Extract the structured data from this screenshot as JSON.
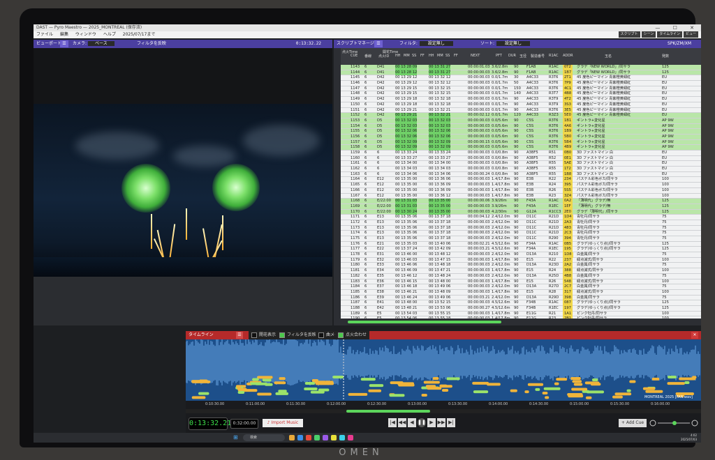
{
  "window": {
    "title": "DAST — Pyro Maestro — 2025_MONTREAL (保存済)",
    "menu": [
      "ファイル",
      "編集",
      "ウィンドウ",
      "ヘルプ",
      "2025/07/17まで"
    ],
    "toolbar_right": [
      "スクリプト",
      "シーン",
      "タイムライン",
      "ビュー"
    ]
  },
  "viewport": {
    "title": "ビューポート",
    "camera_label": "カメラ:",
    "camera_value": "ベース",
    "filter_toggle": "フィルタを反映",
    "timecode": "0:13:32.22"
  },
  "script_manager": {
    "title": "スクリプトマネージャー",
    "filter_label": "フィルタ:",
    "filter_value": "設定無し",
    "sort_label": "ソート:",
    "sort_value": "設定無し",
    "right_label": "SPK/ZM/XM",
    "columns": [
      "CUE",
      "番線",
      "点火ID",
      "HH",
      "MM",
      "SS",
      "FF",
      "HH",
      "MM",
      "SS",
      "FF",
      "NEXT",
      "PFT",
      "DUR",
      "玉径",
      "製造番号",
      "R1AC",
      "ADDR",
      "玉名",
      "発数"
    ],
    "group_headers": [
      "点火Time",
      "開花Time"
    ],
    "rows": [
      {
        "cue": "1143",
        "line": "6",
        "id": "D41",
        "t": "00 13 28 09",
        "b": "00 13 31 27",
        "next": "00:00:01.03",
        "spec": "3.6/2.8m",
        "dur": "90",
        "code": "F1AB",
        "r": "R1AC",
        "addr": "0T2",
        "name": "グラデ「NEW WORLD」/同サラ",
        "n": "125",
        "hl": "g"
      },
      {
        "cue": "1144",
        "line": "6",
        "id": "D41",
        "t": "00 13 28 12",
        "b": "00 13 31 27",
        "next": "00:00:00.03",
        "spec": "3.6/2.8m",
        "dur": "90",
        "code": "F1AB",
        "r": "R1AC",
        "addr": "1B7",
        "name": "グラデ「NEW WORLD」/同サラ",
        "n": "125",
        "hl": "g"
      },
      {
        "cue": "1145",
        "line": "6",
        "id": "D42",
        "t": "00 13 29 12",
        "b": "00 13 32 12",
        "next": "00:00:00.03",
        "spec": "0.0/1.7m",
        "dur": "30",
        "code": "A4C33",
        "r": "R3T6",
        "addr": "2T1",
        "name": "45 度色ピーマイン 青紫橙黄緑紅",
        "n": "EU",
        "hl": "w"
      },
      {
        "cue": "1146",
        "line": "6",
        "id": "D42",
        "t": "00 13 29 12",
        "b": "00 13 32 12",
        "next": "00:00:00.03",
        "spec": "0.0/1.7m",
        "dur": "50",
        "code": "A4C33",
        "r": "R3T6",
        "addr": "7P9",
        "name": "45 度色ピーマイン 青紫橙黄緑紅",
        "n": "EU",
        "hl": "w"
      },
      {
        "cue": "1147",
        "line": "6",
        "id": "D42",
        "t": "00 13 29 15",
        "b": "00 13 32 15",
        "next": "00:00:00.03",
        "spec": "0.0/1.7m",
        "dur": "150",
        "code": "A4C33",
        "r": "R3T6",
        "addr": "4C1",
        "name": "45 度色ピーマイン 青紫橙黄緑紅",
        "n": "EU",
        "hl": "w"
      },
      {
        "cue": "1148",
        "line": "6",
        "id": "D42",
        "t": "00 13 29 15",
        "b": "00 13 32 15",
        "next": "00:00:00.03",
        "spec": "0.0/1.7m",
        "dur": "140",
        "code": "A4C33",
        "r": "R3T7",
        "addr": "4B8",
        "name": "45 度色ピーマイン 青紫橙黄緑紅",
        "n": "EU",
        "hl": "w"
      },
      {
        "cue": "1149",
        "line": "6",
        "id": "D42",
        "t": "00 13 29 18",
        "b": "00 13 32 18",
        "next": "00:00:00.03",
        "spec": "0.0/1.7m",
        "dur": "90",
        "code": "A4C33",
        "r": "R3T9",
        "addr": "4T2",
        "name": "45 度色ピーマイン 青紫橙黄緑紅",
        "n": "EU",
        "hl": "w"
      },
      {
        "cue": "1150",
        "line": "6",
        "id": "D42",
        "t": "00 13 29 18",
        "b": "00 13 32 18",
        "next": "00:00:00.03",
        "spec": "0.0/1.7m",
        "dur": "90",
        "code": "A4C33",
        "r": "R3T9",
        "addr": "3S3",
        "name": "45 度色ピーマイン 青紫橙黄緑紅",
        "n": "EU",
        "hl": "w"
      },
      {
        "cue": "1151",
        "line": "6",
        "id": "D42",
        "t": "00 13 29 21",
        "b": "00 13 32 21",
        "next": "00:00:00.03",
        "spec": "0.0/1.7m",
        "dur": "90",
        "code": "A4C33",
        "r": "R3T6",
        "addr": "3E5",
        "name": "45 度色ピーマイン 青紫橙黄緑紅",
        "n": "EU",
        "hl": "w"
      },
      {
        "cue": "1152",
        "line": "6",
        "id": "D42",
        "t": "00 13 29 21",
        "b": "00 13 32 21",
        "next": "00:00:02.12",
        "spec": "0.0/1.7m",
        "dur": "120",
        "code": "A4C33",
        "r": "R3Z3",
        "addr": "5E0",
        "name": "45 度色ピーマイン 青紫橙黄緑紅",
        "n": "EU",
        "hl": "g"
      },
      {
        "cue": "1153",
        "line": "6",
        "id": "D5",
        "t": "00 13 32 03",
        "b": "00 13 32 03",
        "next": "00:00:00.03",
        "spec": "0.0/5.6m",
        "dur": "90",
        "code": "C5S",
        "r": "R3T6",
        "addr": "1B1",
        "name": "ギントラ+変化星",
        "n": "AP 9W",
        "hl": "g"
      },
      {
        "cue": "1154",
        "line": "6",
        "id": "D5",
        "t": "00 13 32 03",
        "b": "00 13 32 03",
        "next": "00:00:00.03",
        "spec": "0.0/5.6m",
        "dur": "90",
        "code": "C5S",
        "r": "R3T6",
        "addr": "4A6",
        "name": "ギントラ+変化星",
        "n": "AP 9W",
        "hl": "g"
      },
      {
        "cue": "1155",
        "line": "6",
        "id": "D5",
        "t": "00 13 32 06",
        "b": "00 13 32 06",
        "next": "00:00:00.03",
        "spec": "0.0/5.6m",
        "dur": "90",
        "code": "C5S",
        "r": "R3T6",
        "addr": "1B9",
        "name": "ギントラ+変化星",
        "n": "AP 9W",
        "hl": "g"
      },
      {
        "cue": "1156",
        "line": "6",
        "id": "D5",
        "t": "00 13 32 06",
        "b": "00 13 32 06",
        "next": "00:00:00.03",
        "spec": "0.0/5.6m",
        "dur": "90",
        "code": "C5S",
        "r": "R3T6",
        "addr": "5B0",
        "name": "ギントラ+変化星",
        "n": "AP 9W",
        "hl": "g"
      },
      {
        "cue": "1157",
        "line": "6",
        "id": "D5",
        "t": "00 13 32 09",
        "b": "00 13 32 09",
        "next": "00:00:00.15",
        "spec": "0.0/5.6m",
        "dur": "90",
        "code": "C5S",
        "r": "R3T6",
        "addr": "5B4",
        "name": "ギントラ+変化星",
        "n": "AP 9W",
        "hl": "g"
      },
      {
        "cue": "1158",
        "line": "6",
        "id": "D5",
        "t": "00 13 32 09",
        "b": "00 13 32 09",
        "next": "00:00:00.03",
        "spec": "0.0/5.6m",
        "dur": "90",
        "code": "C5S",
        "r": "R3T6",
        "addr": "4B9",
        "name": "ギントラ+変化星",
        "n": "AP 9W",
        "hl": "g"
      },
      {
        "cue": "1159",
        "line": "6",
        "id": "6",
        "t": "00 13 33 24",
        "b": "00 13 33 24",
        "next": "00:00:00.03",
        "spec": "0.0/0.8m",
        "dur": "90",
        "code": "A3BF5",
        "r": "R51",
        "addr": "0B0",
        "name": "3D ファストマイン 白",
        "n": "EU",
        "hl": "w"
      },
      {
        "cue": "1160",
        "line": "6",
        "id": "6",
        "t": "00 13 33 27",
        "b": "00 13 33 27",
        "next": "00:00:00.03",
        "spec": "0.0/0.8m",
        "dur": "90",
        "code": "A3BF5",
        "r": "R52",
        "addr": "0E1",
        "name": "3D ファストマイン 白",
        "n": "EU",
        "hl": "w"
      },
      {
        "cue": "1161",
        "line": "6",
        "id": "6",
        "t": "00 13 34 00",
        "b": "00 13 34 00",
        "next": "00:00:00.03",
        "spec": "0.0/0.8m",
        "dur": "90",
        "code": "A3BF5",
        "r": "R55",
        "addr": "5AE",
        "name": "3D ファストマイン 白",
        "n": "EU",
        "hl": "w"
      },
      {
        "cue": "1162",
        "line": "6",
        "id": "6",
        "t": "00 13 34 03",
        "b": "00 13 34 03",
        "next": "00:00:00.03",
        "spec": "0.0/0.8m",
        "dur": "90",
        "code": "A3BF5",
        "r": "R55",
        "addr": "1T2",
        "name": "3D ファストマイン 白",
        "n": "EU",
        "hl": "w"
      },
      {
        "cue": "1163",
        "line": "6",
        "id": "6",
        "t": "00 13 34 06",
        "b": "00 13 34 06",
        "next": "00:00:00.24",
        "spec": "0.0/0.8m",
        "dur": "90",
        "code": "A3BF5",
        "r": "R55",
        "addr": "1B8",
        "name": "3D ファストマイン 白",
        "n": "EU",
        "hl": "w"
      },
      {
        "cue": "1164",
        "line": "6",
        "id": "E12",
        "t": "00 13 35 00",
        "b": "00 13 36 06",
        "next": "00:00:00.03",
        "spec": "1.4/17.8m",
        "dur": "90",
        "code": "E3B",
        "r": "R22",
        "addr": "234",
        "name": "パステル彩色ボカ/同サラ",
        "n": "100",
        "hl": "w"
      },
      {
        "cue": "1165",
        "line": "6",
        "id": "E12",
        "t": "00 13 35 00",
        "b": "00 13 36 09",
        "next": "00:00:00.03",
        "spec": "1.4/17.8m",
        "dur": "90",
        "code": "E3B",
        "r": "R24",
        "addr": "395",
        "name": "パステル彩色ボカ/同サラ",
        "n": "100",
        "hl": "w"
      },
      {
        "cue": "1166",
        "line": "6",
        "id": "E12",
        "t": "00 13 35 00",
        "b": "00 13 36 09",
        "next": "00:00:00.03",
        "spec": "1.4/17.8m",
        "dur": "90",
        "code": "E3B",
        "r": "R26",
        "addr": "5S5",
        "name": "パステル彩色ボカ/同サラ",
        "n": "100",
        "hl": "w"
      },
      {
        "cue": "1167",
        "line": "6",
        "id": "E12",
        "t": "00 13 35 00",
        "b": "00 13 36 12",
        "next": "00:00:00.03",
        "spec": "1.4/17.8m",
        "dur": "90",
        "code": "E3B",
        "r": "R23",
        "addr": "3Z4",
        "name": "パステル彩色ボカ/同サラ",
        "n": "100",
        "hl": "w"
      },
      {
        "cue": "1168",
        "line": "6",
        "id": "E/22:00",
        "t": "00 13 31 03",
        "b": "00 13 35 00",
        "next": "00:00:00.06",
        "spec": "3.9/26m",
        "dur": "90",
        "code": "F43A",
        "r": "R1AC",
        "addr": "0A2",
        "name": "「薄明代」グラデ/無",
        "n": "125",
        "hl": "g"
      },
      {
        "cue": "1169",
        "line": "6",
        "id": "E/22:00",
        "t": "00 13 31 03",
        "b": "00 13 35 00",
        "next": "00:00:00.03",
        "spec": "3.9/26m",
        "dur": "90",
        "code": "F43A",
        "r": "R1EC",
        "addr": "1EF",
        "name": "「薄明代」グラデ/無",
        "n": "125",
        "hl": "g"
      },
      {
        "cue": "1170",
        "line": "6",
        "id": "E/22:00",
        "t": "00 13 30 24",
        "b": "00 13 35 00",
        "next": "00:00:00.03",
        "spec": "4.2/30m",
        "dur": "90",
        "code": "G12A",
        "r": "R1CC3",
        "addr": "2E0",
        "name": "グラデ「薄明代」/同サラ",
        "n": "125",
        "hl": "g"
      },
      {
        "cue": "1171",
        "line": "6",
        "id": "E13",
        "t": "00 13 35 06",
        "b": "00 13 37 18",
        "next": "00:00:04.12",
        "spec": "2.4/12.0m",
        "dur": "90",
        "code": "D11C",
        "r": "R21D",
        "addr": "1D4",
        "name": "青牡丹/同サラ",
        "n": "75",
        "hl": "w"
      },
      {
        "cue": "1172",
        "line": "6",
        "id": "E13",
        "t": "00 13 35 06",
        "b": "00 13 37 18",
        "next": "00:00:00.03",
        "spec": "2.4/12.0m",
        "dur": "90",
        "code": "D11C",
        "r": "R21D",
        "addr": "2A3",
        "name": "青牡丹/同サラ",
        "n": "75",
        "hl": "w"
      },
      {
        "cue": "1173",
        "line": "6",
        "id": "E13",
        "t": "00 13 35 06",
        "b": "00 13 37 18",
        "next": "00:00:00.03",
        "spec": "2.4/12.0m",
        "dur": "90",
        "code": "D11C",
        "r": "R21D",
        "addr": "483",
        "name": "青牡丹/同サラ",
        "n": "75",
        "hl": "w"
      },
      {
        "cue": "1174",
        "line": "6",
        "id": "E13",
        "t": "00 13 35 06",
        "b": "00 13 37 18",
        "next": "00:00:00.03",
        "spec": "2.4/12.0m",
        "dur": "90",
        "code": "D11C",
        "r": "R21D",
        "addr": "2C3",
        "name": "青牡丹/同サラ",
        "n": "75",
        "hl": "w"
      },
      {
        "cue": "1175",
        "line": "6",
        "id": "E13",
        "t": "00 13 35 06",
        "b": "00 13 37 18",
        "next": "00:00:00.03",
        "spec": "2.4/12.0m",
        "dur": "90",
        "code": "D11C",
        "r": "R290",
        "addr": "394",
        "name": "青牡丹/同サラ",
        "n": "75",
        "hl": "w"
      },
      {
        "cue": "1176",
        "line": "6",
        "id": "E21",
        "t": "00 13 35 03",
        "b": "00 13 40 06",
        "next": "00:00:02.21",
        "spec": "4.5/12.6m",
        "dur": "90",
        "code": "F34A",
        "r": "R1AC",
        "addr": "0B5",
        "name": "グラデ(ゆっくり点)/同サラ",
        "n": "125",
        "hl": "w"
      },
      {
        "cue": "1177",
        "line": "6",
        "id": "E22",
        "t": "00 13 37 24",
        "b": "00 13 42 09",
        "next": "00:00:03.21",
        "spec": "4.5/12.6m",
        "dur": "90",
        "code": "F34A",
        "r": "R1EC",
        "addr": "195",
        "name": "グラデ(ゆっくり点)/同サラ",
        "n": "125",
        "hl": "w"
      },
      {
        "cue": "1178",
        "line": "6",
        "id": "E31",
        "t": "00 13 46 00",
        "b": "00 13 48 12",
        "next": "00:00:00.03",
        "spec": "2.4/12.0m",
        "dur": "90",
        "code": "D13A",
        "r": "R210",
        "addr": "1D8",
        "name": "白金属/同サラ",
        "n": "75",
        "hl": "w"
      },
      {
        "cue": "1179",
        "line": "6",
        "id": "E32",
        "t": "00 13 46 03",
        "b": "00 13 47 15",
        "next": "00:00:00.03",
        "spec": "1.4/17.8m",
        "dur": "90",
        "code": "E15",
        "r": "R22",
        "addr": "237",
        "name": "緑点滅式/同サラ",
        "n": "100",
        "hl": "w"
      },
      {
        "cue": "1180",
        "line": "6",
        "id": "E33",
        "t": "00 13 46 06",
        "b": "00 13 48 18",
        "next": "00:00:00.03",
        "spec": "2.4/12.0m",
        "dur": "90",
        "code": "D13A",
        "r": "R23D",
        "addr": "2A2",
        "name": "白金属/同サラ",
        "n": "75",
        "hl": "w"
      },
      {
        "cue": "1181",
        "line": "6",
        "id": "E34",
        "t": "00 13 46 09",
        "b": "00 13 47 21",
        "next": "00:00:00.03",
        "spec": "1.4/17.8m",
        "dur": "90",
        "code": "E15",
        "r": "R24",
        "addr": "388",
        "name": "緑点滅式/同サラ",
        "n": "100",
        "hl": "w"
      },
      {
        "cue": "1182",
        "line": "6",
        "id": "E35",
        "t": "00 13 46 12",
        "b": "00 13 48 24",
        "next": "00:00:00.03",
        "spec": "2.4/12.0m",
        "dur": "90",
        "code": "D13A",
        "r": "R25D",
        "addr": "4B8",
        "name": "白金属/同サラ",
        "n": "75",
        "hl": "w"
      },
      {
        "cue": "1183",
        "line": "6",
        "id": "E36",
        "t": "00 13 46 15",
        "b": "00 13 48 00",
        "next": "00:00:00.03",
        "spec": "1.4/17.8m",
        "dur": "90",
        "code": "E15",
        "r": "R26",
        "addr": "548",
        "name": "緑点滅式/同サラ",
        "n": "100",
        "hl": "w"
      },
      {
        "cue": "1184",
        "line": "6",
        "id": "E37",
        "t": "00 13 46 18",
        "b": "00 13 49 06",
        "next": "00:00:00.03",
        "spec": "2.4/12.0m",
        "dur": "90",
        "code": "D13A",
        "r": "R27D",
        "addr": "2C7",
        "name": "白金属/同サラ",
        "n": "75",
        "hl": "w"
      },
      {
        "cue": "1185",
        "line": "6",
        "id": "E38",
        "t": "00 13 46 21",
        "b": "00 13 48 09",
        "next": "00:00:00.03",
        "spec": "1.4/17.8m",
        "dur": "90",
        "code": "E15",
        "r": "R28",
        "addr": "317",
        "name": "緑点滅式/同サラ",
        "n": "100",
        "hl": "w"
      },
      {
        "cue": "1186",
        "line": "6",
        "id": "E39",
        "t": "00 13 46 24",
        "b": "00 13 49 06",
        "next": "00:00:03.21",
        "spec": "2.4/12.0m",
        "dur": "90",
        "code": "D13A",
        "r": "R29D",
        "addr": "398",
        "name": "白金属/同サラ",
        "n": "75",
        "hl": "w"
      },
      {
        "cue": "1187",
        "line": "6",
        "id": "E41",
        "t": "00 13 48 00",
        "b": "00 13 52 15",
        "next": "00:00:00.03",
        "spec": "4.5/12.6m",
        "dur": "90",
        "code": "F34B",
        "r": "R1AC",
        "addr": "087",
        "name": "グラデ(ゆっくり点)/同サラ",
        "n": "125",
        "hl": "w"
      },
      {
        "cue": "1188",
        "line": "6",
        "id": "E42",
        "t": "00 13 48 21",
        "b": "00 13 53 06",
        "next": "00:00:00.27",
        "spec": "4.5/12.6m",
        "dur": "90",
        "code": "F34B",
        "r": "R1EC",
        "addr": "197",
        "name": "グラデ(ゆっくり点)/同サラ",
        "n": "125",
        "hl": "w"
      },
      {
        "cue": "1189",
        "line": "6",
        "id": "E5",
        "t": "00 13 54 03",
        "b": "00 13 55 15",
        "next": "00:00:00.03",
        "spec": "1.4/17.8m",
        "dur": "90",
        "code": "E11G",
        "r": "R21",
        "addr": "1A1",
        "name": "ピンク牡丹/同サラ",
        "n": "100",
        "hl": "w"
      },
      {
        "cue": "1190",
        "line": "6",
        "id": "E5",
        "t": "00 13 54 06",
        "b": "00 13 55 18",
        "next": "00:00:00.03",
        "spec": "1.4/17.8m",
        "dur": "90",
        "code": "E11G",
        "r": "R23",
        "addr": "2B1",
        "name": "ピンク牡丹/同サラ",
        "n": "100",
        "hl": "w"
      },
      {
        "cue": "1191",
        "line": "6",
        "id": "E5",
        "t": "00 13 54 09",
        "b": "00 13 55 21",
        "next": "00:00:00.03",
        "spec": "1.4/17.8m",
        "dur": "90",
        "code": "E11G",
        "r": "R25",
        "addr": "423",
        "name": "ピンク牡丹/同サラ",
        "n": "100",
        "hl": "w"
      },
      {
        "cue": "1192",
        "line": "6",
        "id": "E5",
        "t": "00 13 54 12",
        "b": "00 13 55 24",
        "next": "00:00:00.03",
        "spec": "1.4/17.8m",
        "dur": "90",
        "code": "E11G",
        "r": "R27",
        "addr": "291",
        "name": "ピンク牡丹/同サラ",
        "n": "100",
        "hl": "w"
      }
    ]
  },
  "timeline": {
    "title": "タイムライン",
    "options": [
      {
        "label": "開花表示",
        "on": false
      },
      {
        "label": "フィルタを反映",
        "on": true
      },
      {
        "label": "曲メモ",
        "on": false
      },
      {
        "label": "点火合わせ",
        "on": true
      }
    ],
    "ticks": [
      "0:10:30.00",
      "0:11:00.00",
      "0:11:30.00",
      "0:12:00.00",
      "0:12:30.00",
      "0:13:00.00",
      "0:13:30.00",
      "0:14:00.00",
      "0:14:30.00",
      "0:15:00.00",
      "0:15:30.00",
      "0:16:00.00"
    ],
    "track_name": "MONTREAL 2025 [FAN.wav]",
    "current_time": "0:13:32.21",
    "end_time": "0:32:00.00",
    "import_music": "Import Music",
    "add_cue": "+ Add Cue",
    "transport": [
      "|◀",
      "◀◀",
      "◀",
      "❚❚",
      "▶",
      "▶▶",
      "▶|"
    ]
  },
  "taskbar": {
    "search_placeholder": "検索",
    "time": "4:02",
    "date": "2025/07/03"
  },
  "device_brand": "OMEN"
}
